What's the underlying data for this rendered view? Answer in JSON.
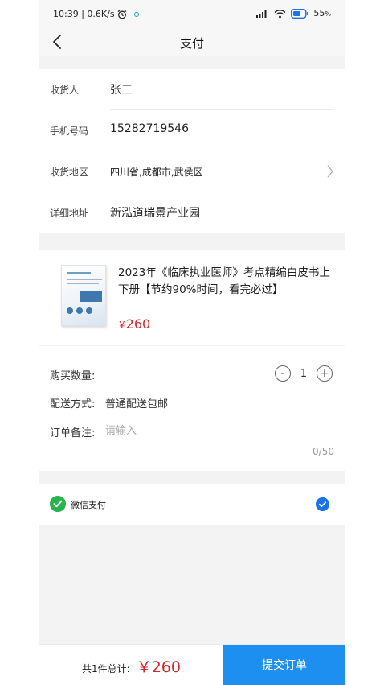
{
  "status_bar": {
    "time_speed": "10:39 | 0.6K/s",
    "battery": "55"
  },
  "nav": {
    "title": "支付"
  },
  "address": {
    "rows": [
      {
        "label": "收货人",
        "value": "张三"
      },
      {
        "label": "手机号码",
        "value": "15282719546"
      },
      {
        "label": "收货地区",
        "value": "四川省,成都市,武侯区"
      },
      {
        "label": "详细地址",
        "value": "新泓道瑞景产业园"
      }
    ]
  },
  "product": {
    "title": "2023年《临床执业医师》考点精编白皮书上下册【节约90%时间，看完必过】",
    "currency": "¥",
    "price": "260"
  },
  "order": {
    "quantity_label": "购买数量:",
    "quantity": "1",
    "minus": "-",
    "plus": "+",
    "delivery_label": "配送方式:",
    "delivery_value": "普通配送包邮",
    "remark_label": "订单备注:",
    "remark_placeholder": "请输入",
    "remark_counter": "0/50"
  },
  "payment": {
    "method": "微信支付"
  },
  "footer": {
    "total_label": "共1件总计:",
    "total_price": "￥260",
    "submit_label": "提交订单"
  },
  "colors": {
    "accent": "#1c8ff0",
    "price": "#d0282c",
    "wechat": "#2ab34d",
    "check": "#1b73e8"
  }
}
